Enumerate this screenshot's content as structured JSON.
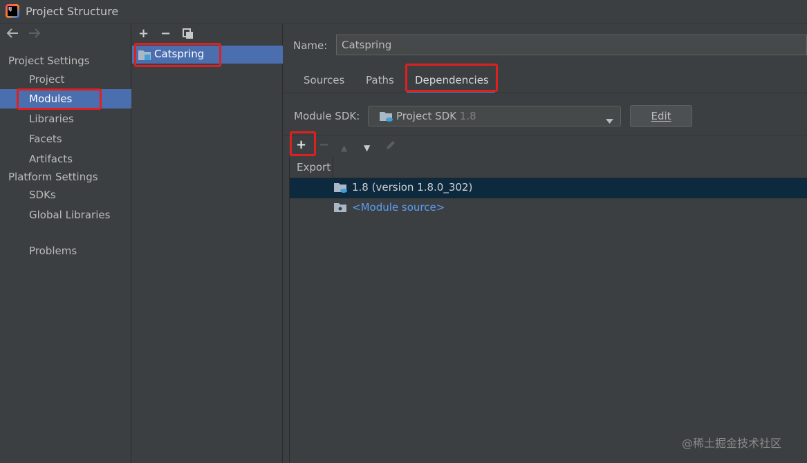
{
  "window": {
    "title": "Project Structure",
    "app_icon_text": "IJ"
  },
  "nav": {
    "back_icon": "arrow-left-icon",
    "forward_icon": "arrow-right-icon"
  },
  "left": {
    "project_settings_header": "Project Settings",
    "project_settings_items": [
      {
        "label": "Project"
      },
      {
        "label": "Modules",
        "selected": true
      },
      {
        "label": "Libraries"
      },
      {
        "label": "Facets"
      },
      {
        "label": "Artifacts"
      }
    ],
    "platform_settings_header": "Platform Settings",
    "platform_settings_items": [
      {
        "label": "SDKs"
      },
      {
        "label": "Global Libraries"
      }
    ],
    "problems_label": "Problems"
  },
  "middle": {
    "toolbar": {
      "add": "+",
      "remove": "−",
      "copy_icon": "copy-icon"
    },
    "modules": [
      {
        "label": "Catspring",
        "selected": true
      }
    ]
  },
  "right": {
    "name_label": "Name:",
    "name_value": "Catspring",
    "tabs": [
      {
        "label": "Sources"
      },
      {
        "label": "Paths"
      },
      {
        "label": "Dependencies",
        "active": true
      }
    ],
    "sdk_label": "Module SDK:",
    "sdk_value": "Project SDK",
    "sdk_version": "1.8",
    "edit_label": "Edit",
    "dep_toolbar": {
      "add": "+",
      "remove": "−",
      "up": "▲",
      "down": "▼",
      "edit_icon": "pencil-icon"
    },
    "table": {
      "header_export": "Export",
      "rows": [
        {
          "label": "1.8 (version 1.8.0_302)",
          "selected": true,
          "icon": "jdk-folder-icon"
        },
        {
          "label": "<Module source>",
          "selected": false,
          "icon": "module-source-folder-icon"
        }
      ]
    }
  },
  "colors": {
    "accent": "#4b6eaf",
    "highlight": "#e02020",
    "link": "#589df6",
    "selected_row": "#0d293e"
  },
  "watermark": "@稀土掘金技术社区"
}
